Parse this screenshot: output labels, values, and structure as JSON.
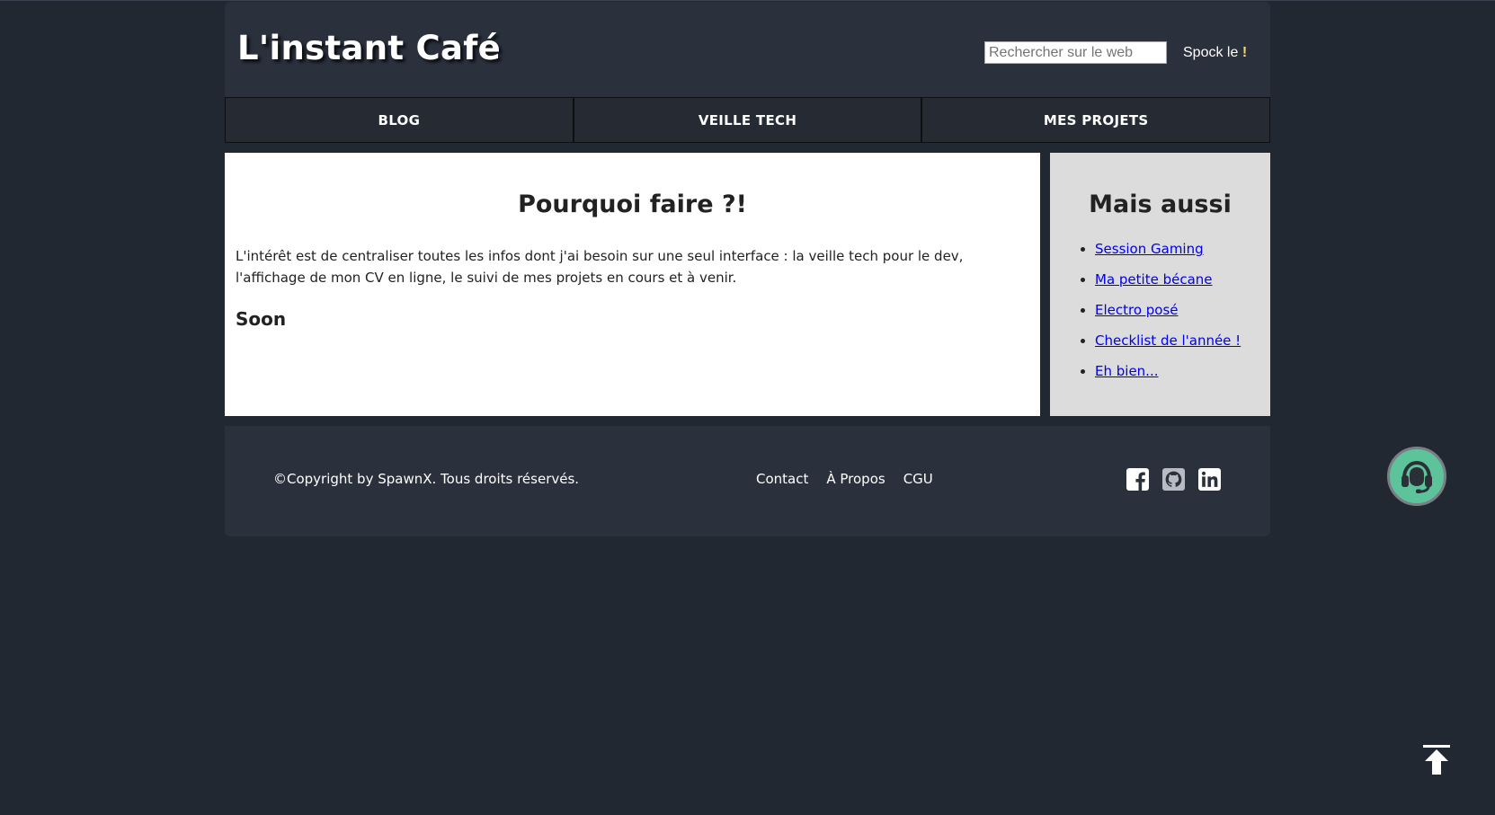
{
  "header": {
    "site_title": "L'instant Café",
    "search_placeholder": "Rechercher sur le web",
    "search_button_label": "Spock le",
    "search_button_bang": "!"
  },
  "nav": {
    "items": [
      {
        "label": "BLOG"
      },
      {
        "label": "VEILLE TECH"
      },
      {
        "label": "MES PROJETS"
      }
    ]
  },
  "article": {
    "title": "Pourquoi faire ?!",
    "text": "L'intérêt est de centraliser toutes les infos dont j'ai besoin sur une seul interface : la veille tech pour le dev, l'affichage de mon CV en ligne, le suivi de mes projets en cours et à venir.",
    "subtitle": "Soon"
  },
  "aside": {
    "title": "Mais aussi",
    "links": [
      {
        "label": "Session Gaming"
      },
      {
        "label": "Ma petite bécane"
      },
      {
        "label": "Electro posé"
      },
      {
        "label": "Checklist de l'année !"
      },
      {
        "label": "Eh bien..."
      }
    ]
  },
  "footer": {
    "copyright": "©Copyright by SpawnX. Tous droits réservés.",
    "links": [
      {
        "label": "Contact"
      },
      {
        "label": "À Propos"
      },
      {
        "label": "CGU"
      }
    ],
    "social": [
      {
        "icon": "facebook-icon"
      },
      {
        "icon": "github-icon"
      },
      {
        "icon": "linkedin-icon"
      }
    ]
  },
  "floating": {
    "support_icon": "headset-icon",
    "scroll_top_icon": "arrow-up-bar-icon"
  },
  "colors": {
    "page_background": "#222831",
    "header_background": "#2a303c",
    "nav_background": "#252a33",
    "aside_background": "#dcdcdc",
    "support_button": "#5cc39a",
    "link": "#0000ee"
  }
}
